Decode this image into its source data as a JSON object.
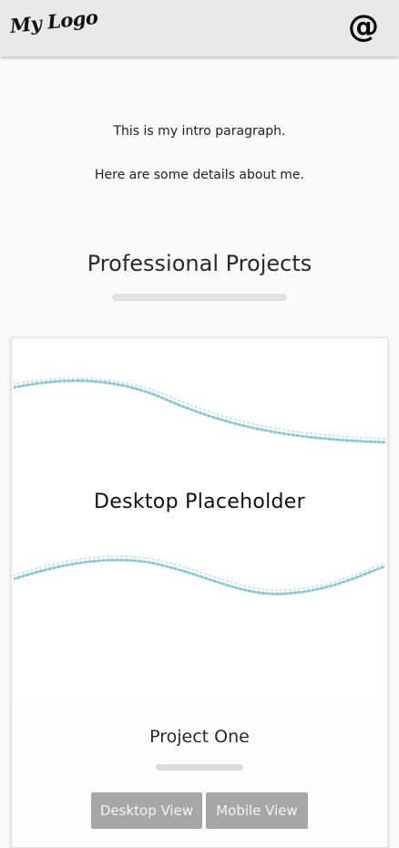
{
  "header": {
    "logo_text": "My Logo",
    "contact_icon": "at-sign-icon",
    "contact_glyph": "@"
  },
  "intro": {
    "paragraph_1": "This is my intro paragraph.",
    "paragraph_2": "Here are some details about me."
  },
  "projects_section": {
    "title": "Professional Projects",
    "projects": [
      {
        "preview_label": "Desktop Placeholder",
        "name": "Project One",
        "buttons": {
          "desktop_label": "Desktop View",
          "mobile_label": "Mobile View"
        }
      }
    ]
  },
  "colors": {
    "header_bg": "#e9e9e9",
    "page_bg": "#fafafa",
    "button_bg": "#a7a7a7",
    "wave_accent": "#7ec3d6"
  }
}
